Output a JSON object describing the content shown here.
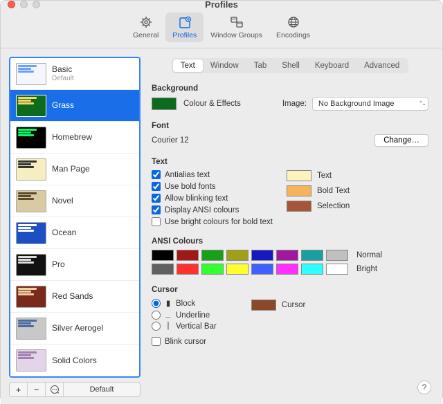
{
  "window": {
    "title": "Profiles"
  },
  "toolbar": [
    {
      "id": "general",
      "label": "General",
      "selected": false
    },
    {
      "id": "profiles",
      "label": "Profiles",
      "selected": true
    },
    {
      "id": "window-groups",
      "label": "Window Groups",
      "selected": false
    },
    {
      "id": "encodings",
      "label": "Encodings",
      "selected": false
    }
  ],
  "profiles": [
    {
      "name": "Basic",
      "sub": "Default",
      "selected": false,
      "bg": "#f4f6fb",
      "fg": "#6aa0ff"
    },
    {
      "name": "Grass",
      "sub": "",
      "selected": true,
      "bg": "#0d6b1f",
      "fg": "#f8d66b"
    },
    {
      "name": "Homebrew",
      "sub": "",
      "selected": false,
      "bg": "#000000",
      "fg": "#00ff66"
    },
    {
      "name": "Man Page",
      "sub": "",
      "selected": false,
      "bg": "#f6eec0",
      "fg": "#333333"
    },
    {
      "name": "Novel",
      "sub": "",
      "selected": false,
      "bg": "#d9caa3",
      "fg": "#5a4a2a"
    },
    {
      "name": "Ocean",
      "sub": "",
      "selected": false,
      "bg": "#1d4fc4",
      "fg": "#ffffff"
    },
    {
      "name": "Pro",
      "sub": "",
      "selected": false,
      "bg": "#111111",
      "fg": "#dddddd"
    },
    {
      "name": "Red Sands",
      "sub": "",
      "selected": false,
      "bg": "#7a2a1a",
      "fg": "#f0d0a0"
    },
    {
      "name": "Silver Aerogel",
      "sub": "",
      "selected": false,
      "bg": "#c8c8c8",
      "fg": "#4a6aa0"
    },
    {
      "name": "Solid Colors",
      "sub": "",
      "selected": false,
      "bg": "#e4d4e8",
      "fg": "#a080b0"
    }
  ],
  "footer": {
    "default_btn": "Default"
  },
  "tabs": [
    "Text",
    "Window",
    "Tab",
    "Shell",
    "Keyboard",
    "Advanced"
  ],
  "active_tab": "Text",
  "sections": {
    "background": {
      "header": "Background",
      "btn": "Colour & Effects",
      "image_lbl": "Image:",
      "dropdown": "No Background Image",
      "swatch": "#0d6b1f"
    },
    "font": {
      "header": "Font",
      "value": "Courier 12",
      "btn": "Change…"
    },
    "text": {
      "header": "Text",
      "checks": [
        {
          "label": "Antialias text",
          "checked": true
        },
        {
          "label": "Use bold fonts",
          "checked": true
        },
        {
          "label": "Allow blinking text",
          "checked": true
        },
        {
          "label": "Display ANSI colours",
          "checked": true
        },
        {
          "label": "Use bright colours for bold text",
          "checked": false
        }
      ],
      "colors": [
        {
          "label": "Text",
          "color": "#fdf3bf"
        },
        {
          "label": "Bold Text",
          "color": "#f6b45a"
        },
        {
          "label": "Selection",
          "color": "#a5553a"
        }
      ]
    },
    "ansi": {
      "header": "ANSI Colours",
      "normal_label": "Normal",
      "bright_label": "Bright",
      "normal": [
        "#000000",
        "#a01818",
        "#18a018",
        "#a0a018",
        "#1818c0",
        "#a018a0",
        "#18a0a0",
        "#c0c0c0"
      ],
      "bright": [
        "#606060",
        "#ff3030",
        "#30ff30",
        "#ffff30",
        "#4060ff",
        "#ff30ff",
        "#30ffff",
        "#ffffff"
      ]
    },
    "cursor": {
      "header": "Cursor",
      "options": [
        {
          "label": "Block",
          "glyph": "▮",
          "checked": true
        },
        {
          "label": "Underline",
          "glyph": "_",
          "checked": false
        },
        {
          "label": "Vertical Bar",
          "glyph": "|",
          "checked": false
        }
      ],
      "blink": {
        "label": "Blink cursor",
        "checked": false
      },
      "swatch_label": "Cursor",
      "swatch": "#8a4a2a"
    }
  },
  "help": "?"
}
